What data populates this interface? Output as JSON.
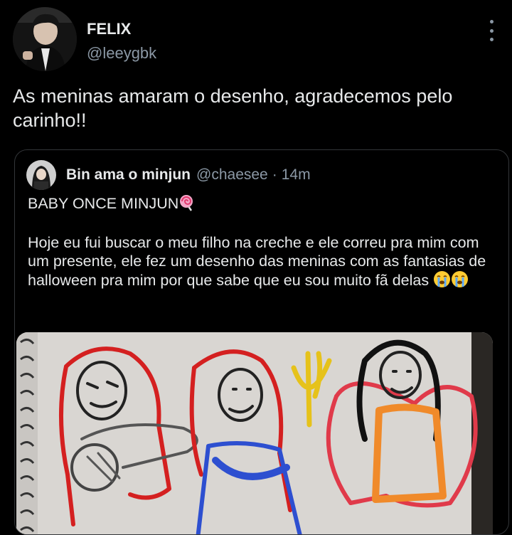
{
  "tweet": {
    "author_name": "FELIX",
    "author_handle": "@leeygbk",
    "text": "As meninas amaram o desenho, agradecemos pelo carinho!!",
    "more_icon": "more-vertical-icon"
  },
  "quoted_tweet": {
    "author_name": "Bin ama o minjun",
    "author_handle": "@chaesee",
    "separator": "·",
    "time": "14m",
    "title_text": "BABY ONCE MINJUN",
    "body_text": "Hoje eu fui buscar o meu filho na creche e ele correu pra mim com um presente, ele fez um desenho das meninas com as fantasias de halloween pra mim por que sabe que eu sou muito fã delas",
    "title_emoji": "lollipop-icon",
    "body_emoji": "crying-face-icon"
  },
  "colors": {
    "background": "#000000",
    "text_primary": "#e7e9ea",
    "text_secondary": "#8b98a5",
    "border": "#333639"
  }
}
